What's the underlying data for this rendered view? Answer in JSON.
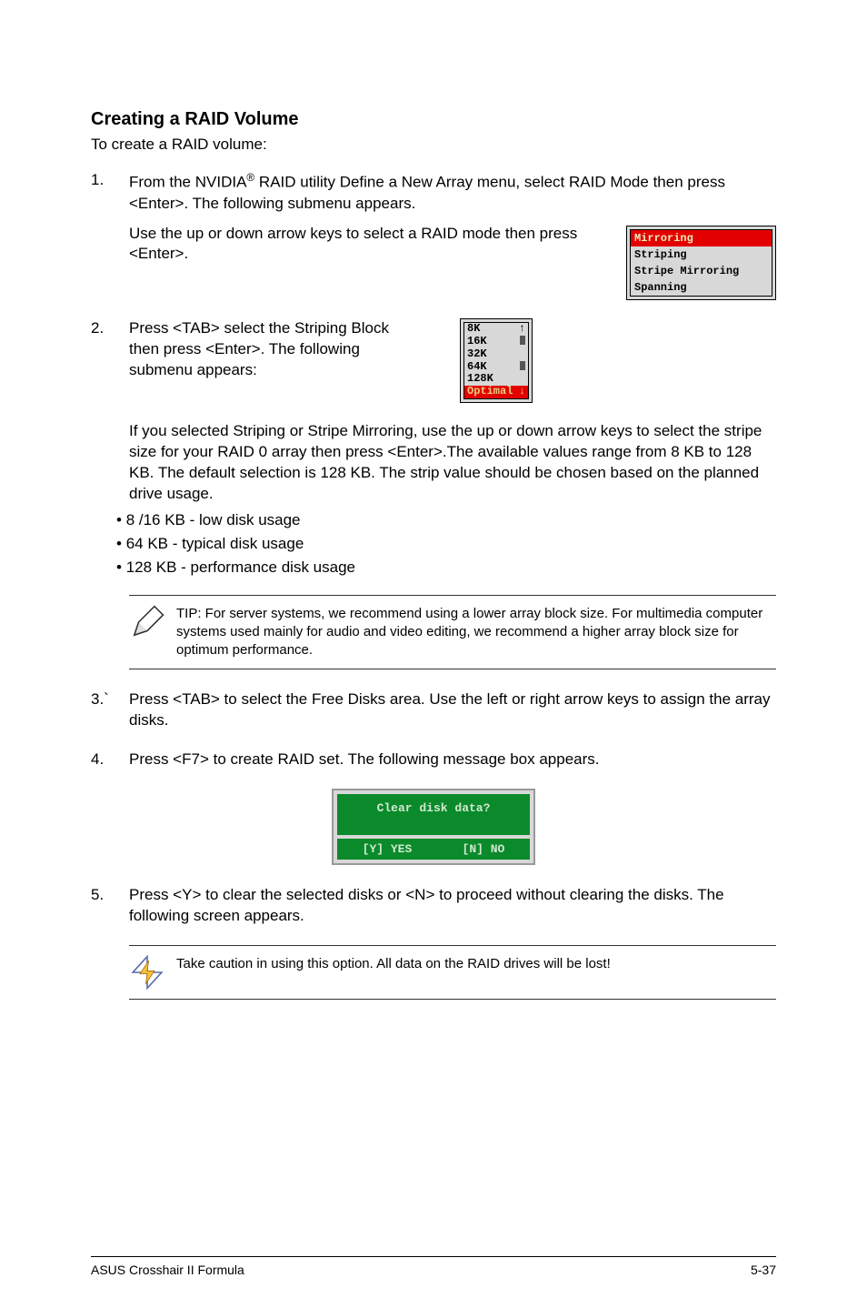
{
  "title": "Creating a RAID Volume",
  "intro": "To create a RAID volume:",
  "steps": {
    "s1": {
      "num": "1.",
      "line1a": "From the NVIDIA",
      "reg": "®",
      "line1b": " RAID utility Define a New Array menu, select RAID Mode then press <Enter>. The following submenu appears.",
      "line2": "Use the up or down arrow keys to select a RAID mode then press <Enter>."
    },
    "s2": {
      "num": "2.",
      "text": "Press <TAB> select the Striping Block then press <Enter>. The following submenu appears:",
      "explain": "If you selected Striping or Stripe Mirroring, use the up or down arrow keys to select the stripe size for your RAID 0 array then press <Enter>.The available values range from 8 KB to 128 KB. The default selection is 128 KB. The strip value should be chosen based on the planned drive usage.",
      "b1": "8 /16 KB - low disk usage",
      "b2": "64 KB - typical disk usage",
      "b3": "128 KB - performance disk usage"
    },
    "s3": {
      "num": "3.`",
      "text": "Press <TAB> to select the Free Disks area. Use the left or right arrow keys to assign the array disks."
    },
    "s4": {
      "num": "4.",
      "text": "Press <F7> to create RAID set. The following message box appears."
    },
    "s5": {
      "num": "5.",
      "text": "Press <Y> to clear the selected disks or <N> to proceed without clearing the disks. The following screen appears."
    }
  },
  "raid_modes": {
    "m1": "Mirroring",
    "m2": "Striping",
    "m3": "Stripe Mirroring",
    "m4": "Spanning"
  },
  "stripe_sizes": {
    "v1": "8K",
    "v2": "16K",
    "v3": "32K",
    "v4": "64K",
    "v5": "128K",
    "sel": "Optimal",
    "arrow_up": "↑",
    "arrow_dn": "↓"
  },
  "tip": "TIP: For server systems, we recommend using a lower array block size. For multimedia computer systems used mainly for audio and video editing, we recommend a higher array block size for optimum performance.",
  "dialog": {
    "title": "Clear disk data?",
    "yes": "[Y] YES",
    "no": "[N] NO"
  },
  "caution": "Take caution in using this option. All data on the RAID drives will be lost!",
  "footer": {
    "left": "ASUS Crosshair II Formula",
    "right": "5-37"
  }
}
